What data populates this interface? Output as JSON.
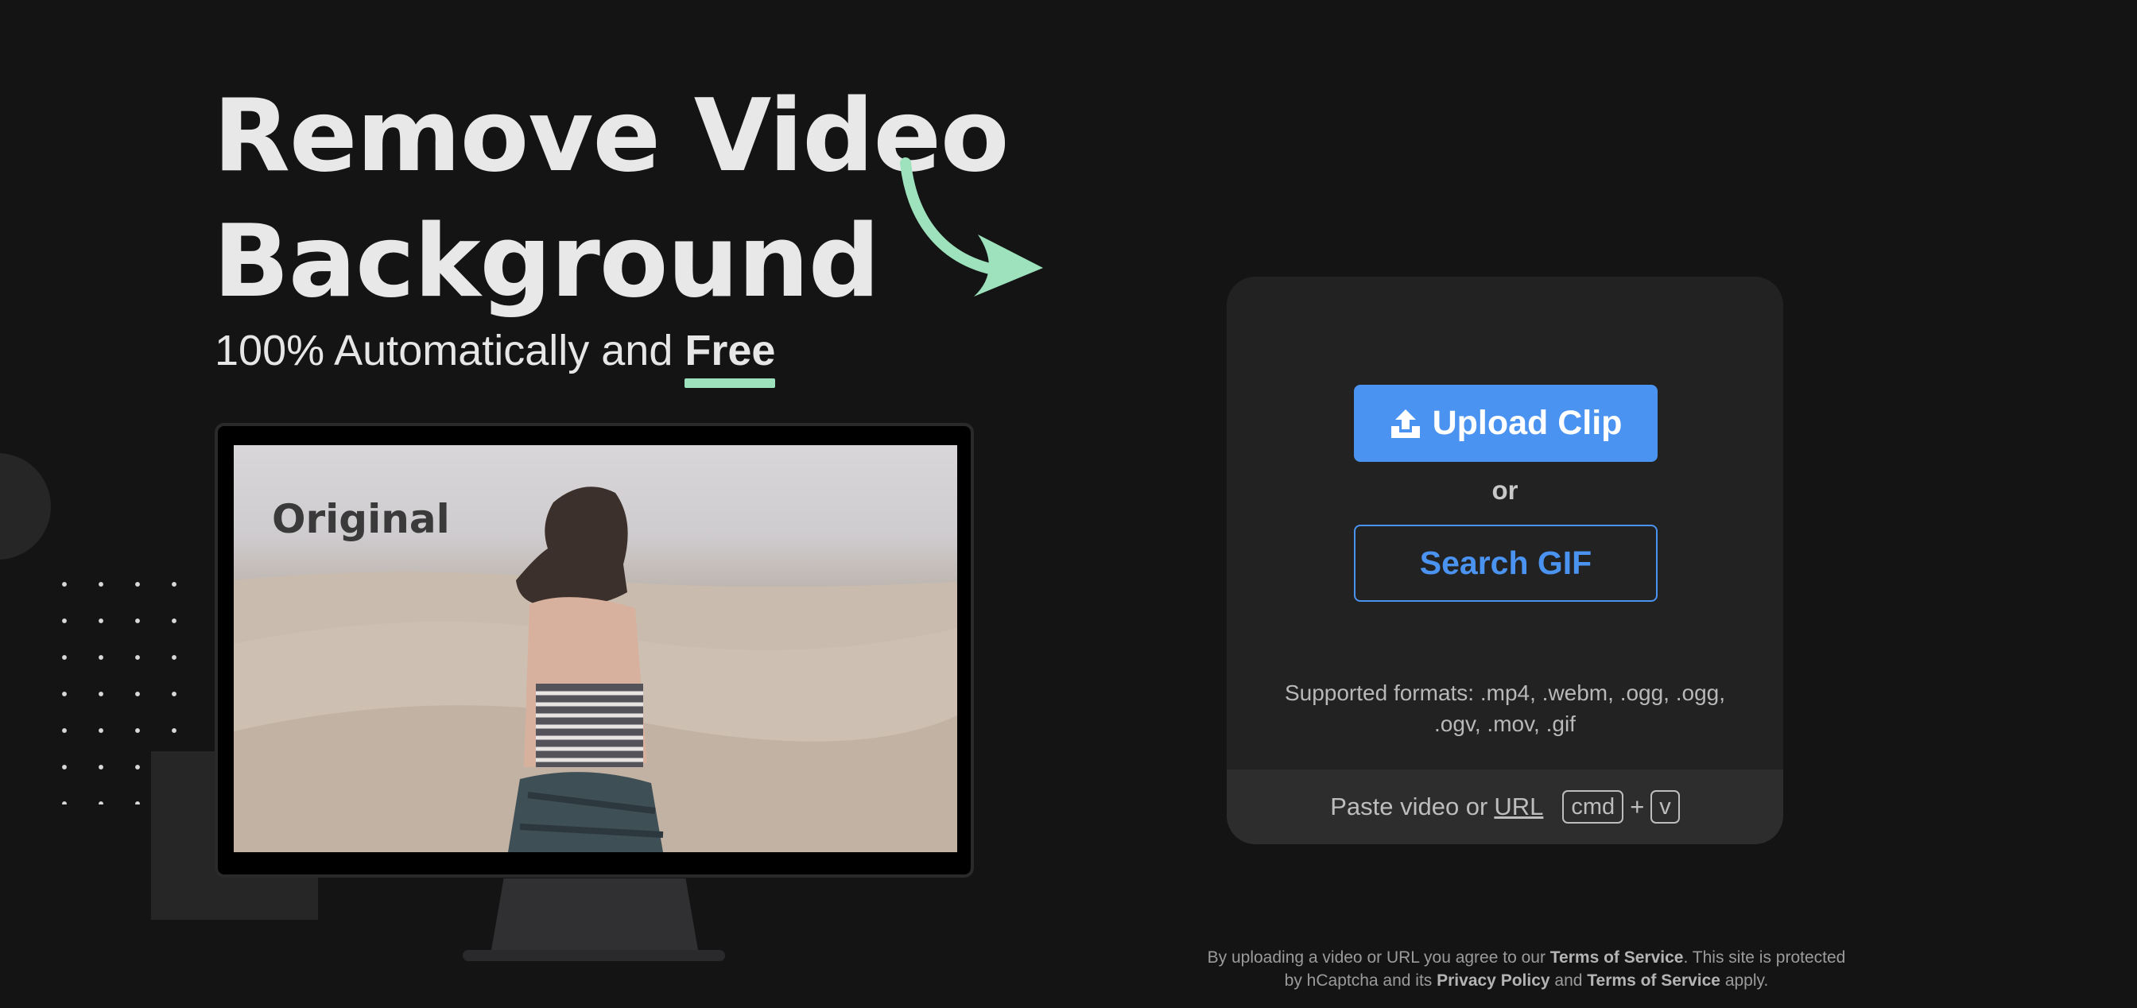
{
  "hero": {
    "title_line1": "Remove Video",
    "title_line2": "Background",
    "subtitle_prefix": "100% Automatically and",
    "subtitle_emphasis": "Free"
  },
  "preview": {
    "label": "Original"
  },
  "upload_card": {
    "upload_label": "Upload Clip",
    "or_label": "or",
    "search_label": "Search GIF",
    "formats_text": "Supported formats: .mp4, .webm, .ogg, .ogg, .ogv, .mov, .gif",
    "paste_prefix": "Paste video or",
    "paste_url": "URL",
    "kbd_cmd": "cmd",
    "kbd_plus": "+",
    "kbd_v": "v"
  },
  "legal": {
    "part1": "By uploading a video or URL you agree to our ",
    "tos1": "Terms of Service",
    "part2": ". This site is protected by hCaptcha and its ",
    "privacy": "Privacy Policy",
    "part3": " and ",
    "tos2": "Terms of Service",
    "part4": " apply."
  },
  "colors": {
    "background": "#141414",
    "accent_blue": "#4b93f0",
    "accent_green": "#9de2bc",
    "card": "#222222"
  },
  "icons": [
    "upload-icon",
    "curved-arrow-icon"
  ]
}
